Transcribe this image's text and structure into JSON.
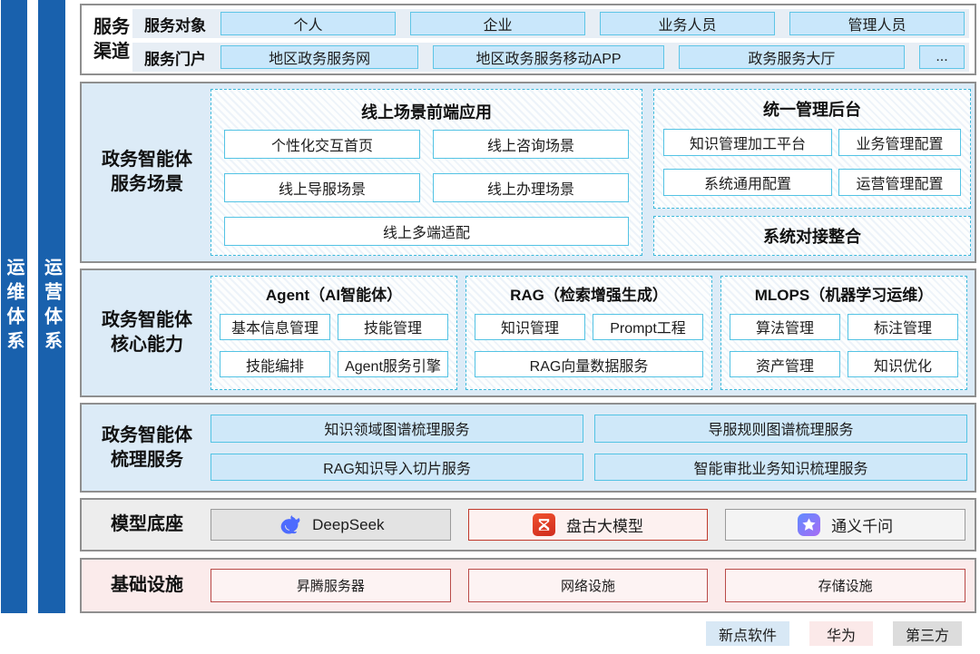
{
  "rails": [
    {
      "label": "运维体系"
    },
    {
      "label": "运营体系"
    }
  ],
  "service_channel": {
    "title": "服务渠道",
    "rows": [
      {
        "label": "服务对象",
        "items": [
          "个人",
          "企业",
          "业务人员",
          "管理人员"
        ]
      },
      {
        "label": "服务门户",
        "items": [
          "地区政务服务网",
          "地区政务服务移动APP",
          "政务服务大厅",
          "..."
        ]
      }
    ]
  },
  "service_scene": {
    "title": "政务智能体服务场景",
    "frontend": {
      "title": "线上场景前端应用",
      "items": [
        "个性化交互首页",
        "线上咨询场景",
        "线上导服场景",
        "线上办理场景",
        "线上多端适配"
      ]
    },
    "admin": {
      "title": "统一管理后台",
      "items": [
        "知识管理加工平台",
        "业务管理配置",
        "系统通用配置",
        "运营管理配置"
      ]
    },
    "integration": {
      "title": "系统对接整合"
    }
  },
  "core_capability": {
    "title": "政务智能体核心能力",
    "groups": [
      {
        "title": "Agent（AI智能体）",
        "items": [
          "基本信息管理",
          "技能管理",
          "技能编排",
          "Agent服务引擎"
        ]
      },
      {
        "title": "RAG（检索增强生成）",
        "items": [
          "知识管理",
          "Prompt工程",
          "RAG向量数据服务"
        ]
      },
      {
        "title": "MLOPS（机器学习运维）",
        "items": [
          "算法管理",
          "标注管理",
          "资产管理",
          "知识优化"
        ]
      }
    ]
  },
  "sorting_service": {
    "title": "政务智能体梳理服务",
    "items": [
      "知识领域图谱梳理服务",
      "导服规则图谱梳理服务",
      "RAG知识导入切片服务",
      "智能审批业务知识梳理服务"
    ]
  },
  "model_base": {
    "title": "模型底座",
    "items": [
      {
        "label": "DeepSeek",
        "icon": "deepseek-whale-icon",
        "icon_color": "#4d6bfe"
      },
      {
        "label": "盘古大模型",
        "icon": "pangu-hourglass-icon",
        "icon_color": "#d8301f"
      },
      {
        "label": "通义千问",
        "icon": "tongyi-star-icon",
        "icon_color": "#7d79fa"
      }
    ]
  },
  "infrastructure": {
    "title": "基础设施",
    "items": [
      "昇腾服务器",
      "网络设施",
      "存储设施"
    ]
  },
  "legend": {
    "items": [
      {
        "label": "新点软件",
        "color": "#d8e8f5"
      },
      {
        "label": "华为",
        "color": "#fbe9e9"
      },
      {
        "label": "第三方",
        "color": "#dcdcdc"
      }
    ]
  },
  "colors": {
    "rail_blue": "#1961ad",
    "section_blue_bg": "#dcebf7",
    "chip_blue_bg": "#c9e7fb",
    "cyan_border": "#53c3e4",
    "dashed_cyan": "#3cb9db",
    "infra_red_border": "#b94a48",
    "infra_pink_bg": "#fbebeb"
  }
}
